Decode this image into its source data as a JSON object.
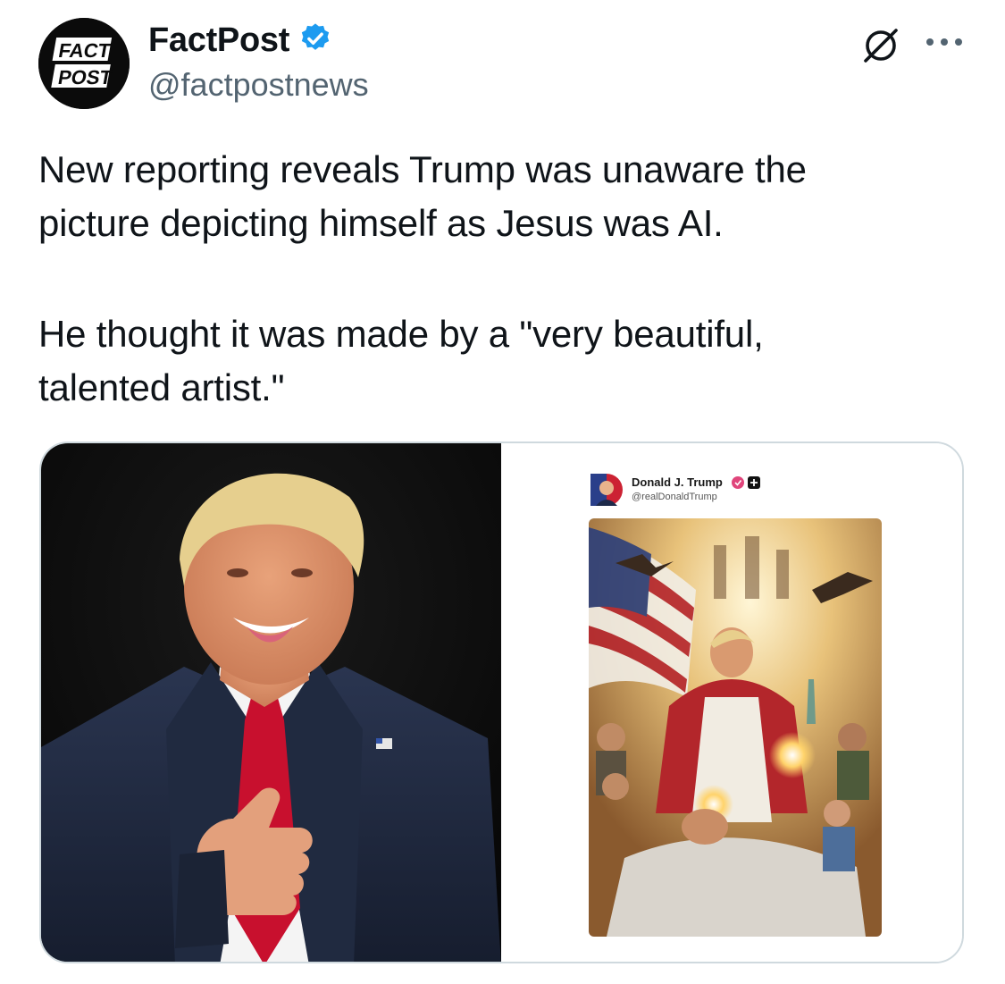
{
  "tweet": {
    "author": {
      "display_name": "FactPost",
      "handle": "@factpostnews",
      "verified": true,
      "avatar_text_line1": "FACT",
      "avatar_text_line2": "POST"
    },
    "text_paragraphs": [
      [
        "New reporting reveals Trump was unaware the",
        "picture depicting himself as Jesus was AI."
      ],
      [
        "He thought it was made by a \"very beautiful,",
        "talented artist.\""
      ]
    ],
    "icons": {
      "grok": "grok-icon",
      "more": "more-options-icon",
      "verified": "verified-badge-icon"
    }
  },
  "media": {
    "embedded_post": {
      "display_name": "Donald J. Trump",
      "handle": "@realDonaldTrump"
    }
  },
  "colors": {
    "verified_blue": "#1d9bf0",
    "secondary_text": "#536471",
    "border": "#cfd9de"
  }
}
